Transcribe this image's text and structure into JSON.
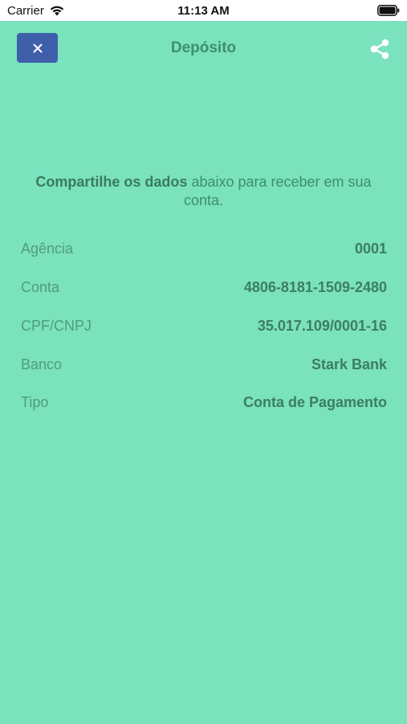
{
  "status_bar": {
    "carrier": "Carrier",
    "time": "11:13 AM"
  },
  "header": {
    "title": "Depósito",
    "close_icon": "close-icon",
    "share_icon": "share-icon"
  },
  "intro": {
    "bold": "Compartilhe os dados",
    "rest": " abaixo para receber em sua conta."
  },
  "info": [
    {
      "label": "Agência",
      "value": "0001"
    },
    {
      "label": "Conta",
      "value": "4806-8181-1509-2480"
    },
    {
      "label": "CPF/CNPJ",
      "value": "35.017.109/0001-16"
    },
    {
      "label": "Banco",
      "value": "Stark Bank"
    },
    {
      "label": "Tipo",
      "value": "Conta de Pagamento"
    }
  ],
  "colors": {
    "background": "#7ae2bd",
    "close_button": "#3f5fab",
    "title": "#3f8f6f"
  }
}
